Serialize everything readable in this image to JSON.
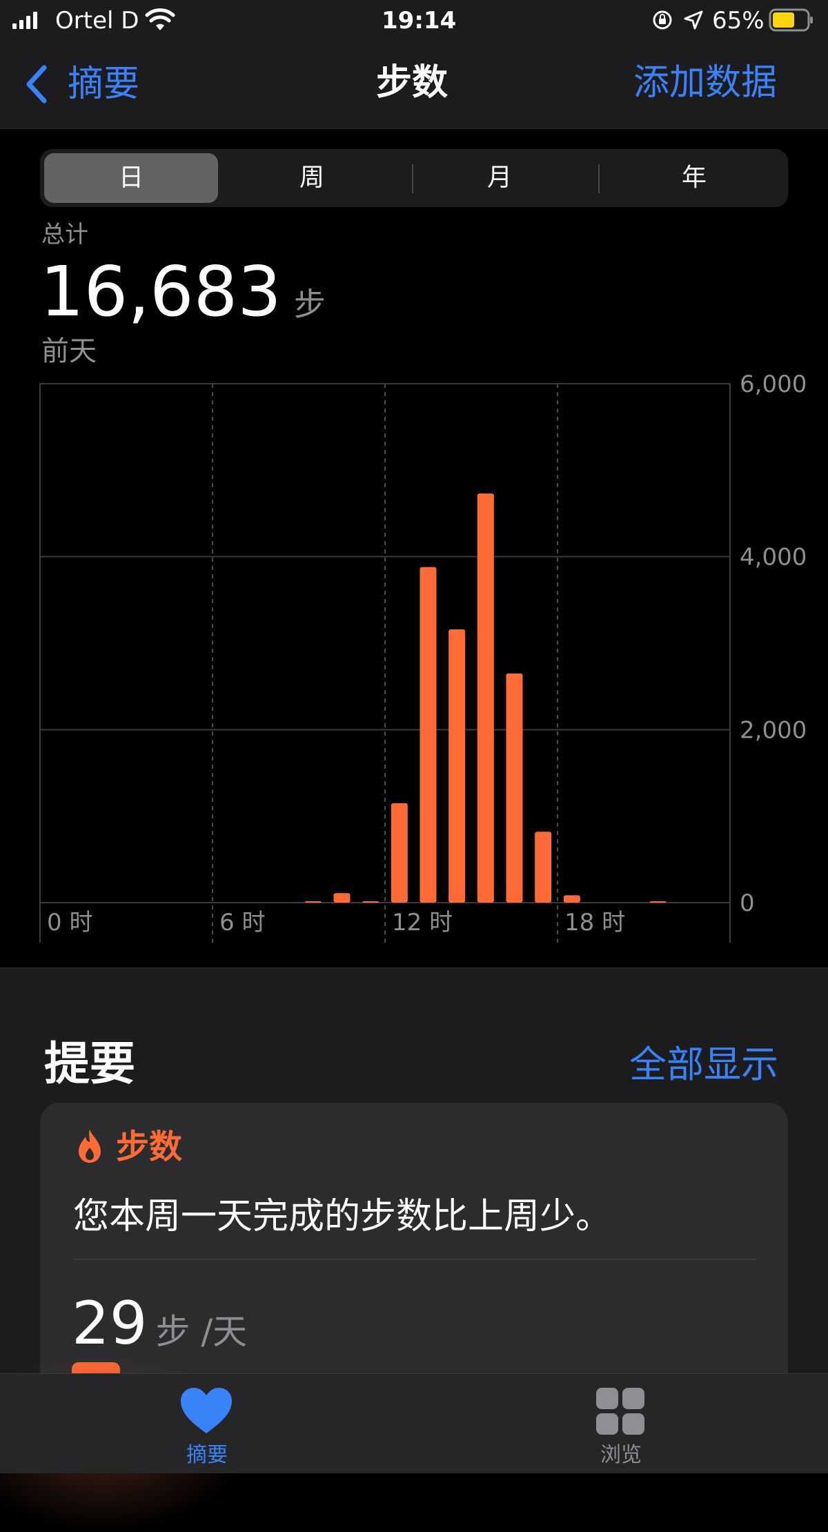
{
  "status_bar": {
    "carrier": "Ortel D",
    "time": "19:14",
    "battery_percent": "65%",
    "battery_level": 0.65
  },
  "nav": {
    "back_label": "摘要",
    "title": "步数",
    "action_label": "添加数据"
  },
  "segments": {
    "items": [
      "日",
      "周",
      "月",
      "年"
    ],
    "selected": "日"
  },
  "totals": {
    "label": "总计",
    "value": "16,683",
    "unit": "步",
    "date": "前天"
  },
  "chart_data": {
    "type": "bar",
    "x_tick_labels": [
      "0 时",
      "6 时",
      "12 时",
      "18 时"
    ],
    "y_tick_labels": [
      "6,000",
      "4,000",
      "2,000",
      "0"
    ],
    "ylim": [
      0,
      6000
    ],
    "grid": true,
    "categories": [
      0,
      1,
      2,
      3,
      4,
      5,
      6,
      7,
      8,
      9,
      10,
      11,
      12,
      13,
      14,
      15,
      16,
      17,
      18,
      19,
      20,
      21,
      22,
      23
    ],
    "values": [
      0,
      0,
      0,
      0,
      0,
      0,
      0,
      0,
      0,
      10,
      110,
      10,
      1150,
      3880,
      3160,
      4730,
      2650,
      820,
      85,
      0,
      0,
      5,
      0,
      0
    ]
  },
  "highlights": {
    "heading": "提要",
    "show_all_label": "全部显示",
    "card": {
      "category": "步数",
      "message": "您本周一天完成的步数比上周少。",
      "value": "29",
      "unit": "步 /天"
    }
  },
  "tab_bar": {
    "tabs": [
      {
        "label": "摘要",
        "icon": "heart-icon",
        "active": true
      },
      {
        "label": "浏览",
        "icon": "grid-icon",
        "active": false
      }
    ]
  },
  "colors": {
    "accent": "#3a82f7",
    "bar": "#ff6b35",
    "background": "#000000",
    "panel": "#1c1c1e"
  }
}
